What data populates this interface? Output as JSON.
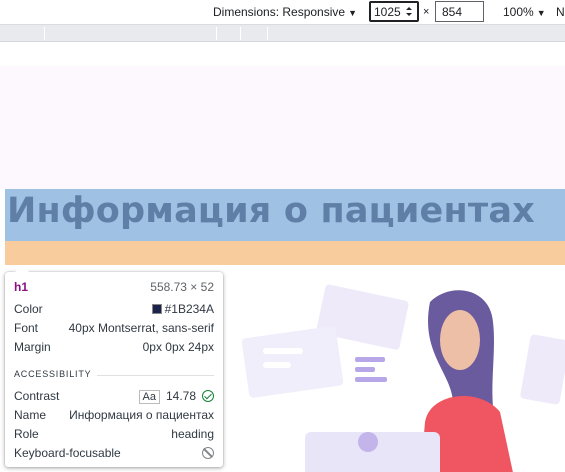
{
  "toolbar": {
    "dimensions_label": "Dimensions: Responsive",
    "width": "1025",
    "times": "×",
    "height": "854",
    "zoom": "100%",
    "more": "N"
  },
  "page": {
    "heading": "Информация о пациентах"
  },
  "tooltip": {
    "tag": "h1",
    "size": "558.73 × 52",
    "color_label": "Color",
    "color_value": "#1B234A",
    "font_label": "Font",
    "font_value": "40px Montserrat, sans-serif",
    "margin_label": "Margin",
    "margin_value": "0px 0px 24px",
    "section": "ACCESSIBILITY",
    "contrast_label": "Contrast",
    "contrast_aa": "Aa",
    "contrast_value": "14.78",
    "name_label": "Name",
    "name_value": "Информация о пациентах",
    "role_label": "Role",
    "role_value": "heading",
    "focus_label": "Keyboard-focusable"
  },
  "colors": {
    "content_highlight": "#9fc1e4",
    "margin_highlight": "#f9cc9d",
    "swatch": "#1B234A"
  },
  "icons": [
    "caret-down-icon",
    "spinner-icon",
    "check-circle-icon",
    "no-focus-icon"
  ]
}
